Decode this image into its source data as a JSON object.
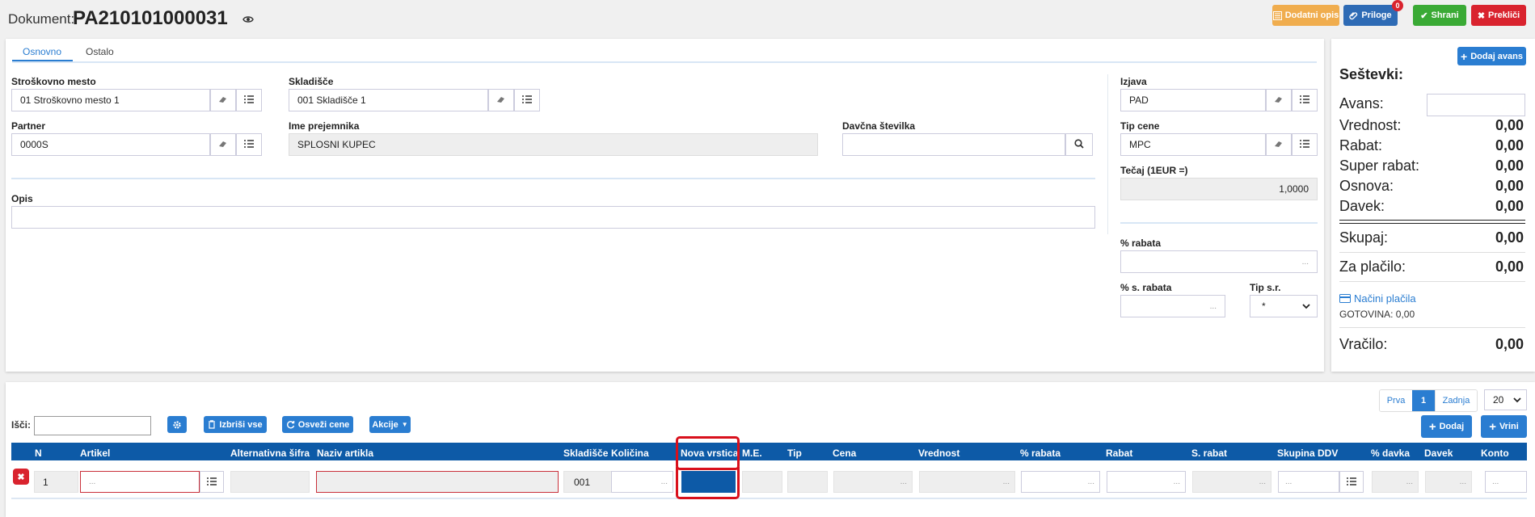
{
  "header": {
    "doc_label": "Dokument:",
    "doc_number": "PA210101000031",
    "buttons": {
      "dodatni_opis": "Dodatni opis",
      "priloge": "Priloge",
      "priloge_badge": "0",
      "shrani": "Shrani",
      "preklici": "Prekliči"
    }
  },
  "tabs": [
    {
      "label": "Osnovno",
      "active": true
    },
    {
      "label": "Ostalo",
      "active": false
    }
  ],
  "form": {
    "strosk_label": "Stroškovno mesto",
    "strosk_value": "01 Stroškovno mesto 1",
    "skladisce_label": "Skladišče",
    "skladisce_value": "001 Skladišče 1",
    "partner_label": "Partner",
    "partner_value": "0000S",
    "ime_label": "Ime prejemnika",
    "ime_value": "SPLOSNI KUPEC",
    "davcna_label": "Davčna številka",
    "davcna_value": "",
    "opis_label": "Opis",
    "opis_value": "",
    "izjava_label": "Izjava",
    "izjava_value": "PAD",
    "tipcene_label": "Tip cene",
    "tipcene_value": "MPC",
    "tecaj_label": "Tečaj (1EUR =)",
    "tecaj_value": "1,0000",
    "rabat_label": "% rabata",
    "srabat_label": "% s. rabata",
    "tipsr_label": "Tip s.r.",
    "tipsr_value": "*",
    "dots": "..."
  },
  "summary": {
    "dodaj_avans": "Dodaj avans",
    "title": "Seštevki:",
    "avans_label": "Avans:",
    "rows": [
      {
        "label": "Vrednost:",
        "value": "0,00"
      },
      {
        "label": "Rabat:",
        "value": "0,00"
      },
      {
        "label": "Super rabat:",
        "value": "0,00"
      },
      {
        "label": "Osnova:",
        "value": "0,00"
      },
      {
        "label": "Davek:",
        "value": "0,00"
      }
    ],
    "skupaj_label": "Skupaj:",
    "skupaj_value": "0,00",
    "zaplacilo_label": "Za plačilo:",
    "zaplacilo_value": "0,00",
    "nacini_placila": "Načini plačila",
    "gotovina": "GOTOVINA: 0,00",
    "vracilo_label": "Vračilo:",
    "vracilo_value": "0,00"
  },
  "table_toolbar": {
    "search_label": "Išči:",
    "izbrisi_vse": "Izbriši vse",
    "osvezi_cene": "Osveži cene",
    "akcije": "Akcije",
    "dodaj": "Dodaj",
    "vrini": "Vrini"
  },
  "pagination": {
    "first": "Prva",
    "current": "1",
    "last": "Zadnja",
    "page_size": "20"
  },
  "table": {
    "columns": [
      "N",
      "Artikel",
      "Alternativna šifra",
      "Naziv artikla",
      "Skladišče",
      "Količina",
      "Nova vrstica",
      "M.E.",
      "Tip",
      "Cena",
      "Vrednost",
      "% rabata",
      "Rabat",
      "S. rabat",
      "Skupina DDV",
      "% davka",
      "Davek",
      "Konto"
    ],
    "row": {
      "n": "1",
      "skladisce": "001"
    }
  },
  "colors": {
    "accent_blue": "#2a7dd1",
    "table_header": "#0d5aa7",
    "green": "#3aaa35",
    "red": "#d9232e",
    "orange": "#f0ad4e",
    "highlight_box": "#d9101c"
  }
}
